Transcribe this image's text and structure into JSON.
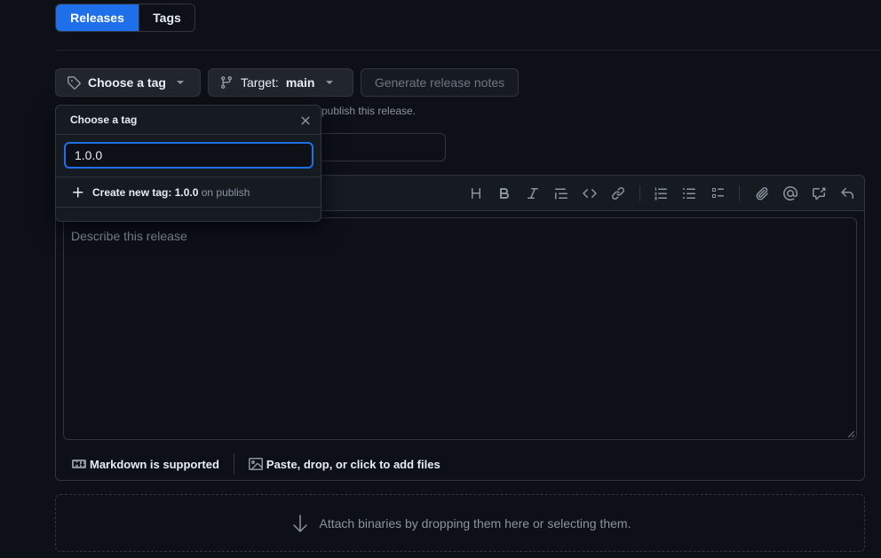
{
  "tabs": [
    {
      "label": "Releases",
      "active": true
    },
    {
      "label": "Tags",
      "active": false
    }
  ],
  "controls": {
    "choose_tag_label": "Choose a tag",
    "target_prefix": "Target:",
    "target_branch": "main",
    "generate_notes_label": "Generate release notes"
  },
  "hint_partial": "publish this release.",
  "editor": {
    "placeholder": "Describe this release",
    "markdown_label": "Markdown is supported",
    "attach_label": "Paste, drop, or click to add files",
    "toolbar_icons": [
      "heading-icon",
      "bold-icon",
      "italic-icon",
      "quote-icon",
      "code-icon",
      "link-icon",
      "ordered-list-icon",
      "unordered-list-icon",
      "task-list-icon",
      "attachment-icon",
      "mention-icon",
      "cross-reference-icon",
      "undo-icon"
    ]
  },
  "dropzone_label": "Attach binaries by dropping them here or selecting them.",
  "popover": {
    "title": "Choose a tag",
    "filter_value": "1.0.0",
    "create_prefix": "Create new tag:",
    "create_tag": "1.0.0",
    "create_suffix": "on publish"
  },
  "colors": {
    "background": "#0d1117",
    "accent": "#1f6feb",
    "border": "#30363d",
    "muted_text": "#8b949e"
  }
}
